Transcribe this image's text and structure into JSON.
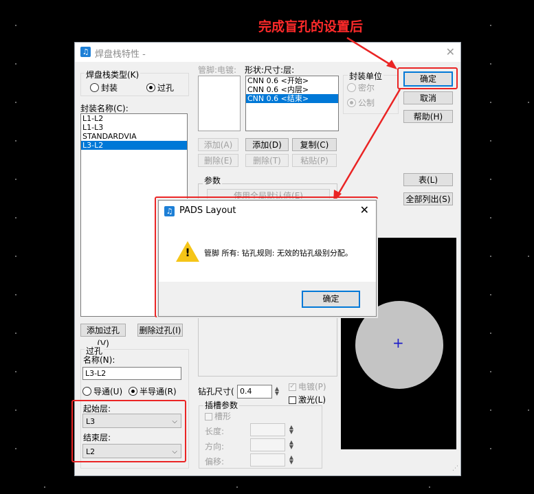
{
  "annotation": {
    "text": "完成盲孔的设置后",
    "color": "#ff2a2a"
  },
  "dialog": {
    "title": "焊盘栈特性 -",
    "stack_type": {
      "label": "焊盘栈类型(K)",
      "options": [
        "封装",
        "过孔"
      ],
      "selected": "过孔"
    },
    "package_name_label": "封装名称(C):",
    "package_names": [
      "L1-L2",
      "L1-L3",
      "STANDARDVIA",
      "L3-L2"
    ],
    "package_selected": "L3-L2",
    "pin_label": "管脚:电镀:",
    "shape_label": "形状:尺寸:层:",
    "shapes": [
      "CNN 0.6 <开始>",
      "CNN 0.6 <内层>",
      "CNN 0.6 <结束>"
    ],
    "shape_selected": "CNN 0.6 <结束>",
    "buttons": {
      "add_pin": "添加(A)",
      "delete_pin": "删除(E)",
      "add_shape": "添加(D)",
      "copy": "复制(C)",
      "delete_shape": "删除(T)",
      "paste": "粘贴(P)",
      "ok": "确定",
      "cancel": "取消",
      "help": "帮助(H)",
      "table": "表(L)",
      "list_all": "全部列出(S)",
      "add_via": "添加过孔(V)",
      "delete_via": "删除过孔(I)",
      "use_global_default": "使用全局默认值(E)"
    },
    "units": {
      "label": "封装单位",
      "options": [
        "密尔",
        "公制"
      ],
      "selected": "公制"
    },
    "params_label": "参数",
    "via": {
      "group_label": "过孔",
      "name_label": "名称(N):",
      "name_value": "L3-L2",
      "type_options": [
        "导通(U)",
        "半导通(R)"
      ],
      "type_selected": "半导通(R)",
      "start_layer_label": "起始层:",
      "start_layer_value": "L3",
      "end_layer_label": "结束层:",
      "end_layer_value": "L2"
    },
    "drill": {
      "size_label": "钻孔尺寸(",
      "size_value": "0.4",
      "plated_label": "电镀(P)",
      "plated": true,
      "laser_label": "激光(L)",
      "laser": false
    },
    "slot": {
      "group_label": "插槽参数",
      "slotted_label": "槽形",
      "length_label": "长度:",
      "direction_label": "方向:",
      "offset_label": "偏移:"
    }
  },
  "alert": {
    "title": "PADS Layout",
    "message": "管脚 所有: 钻孔规则: 无效的钻孔级别分配。",
    "ok": "确定",
    "icon": "warning-icon"
  }
}
